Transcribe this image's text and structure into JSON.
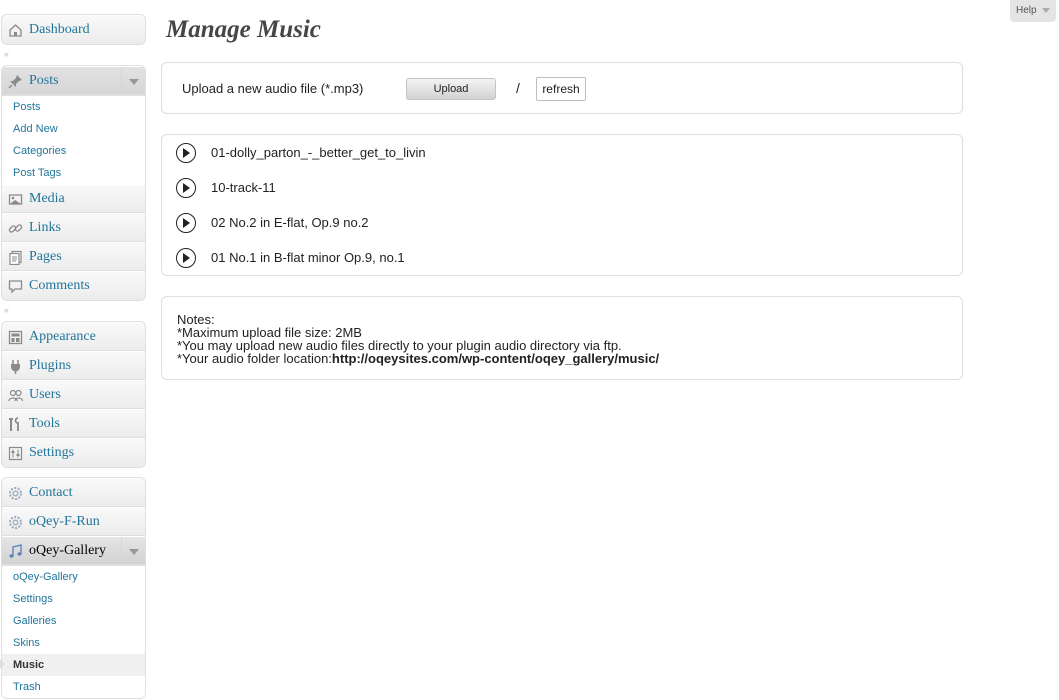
{
  "help": {
    "label": "Help"
  },
  "page": {
    "title": "Manage Music"
  },
  "upload": {
    "label": "Upload a new audio file (*.mp3)",
    "button_label": "Upload",
    "separator": "/",
    "refresh_label": "refresh"
  },
  "tracks": [
    {
      "title": "01-dolly_parton_-_better_get_to_livin"
    },
    {
      "title": "10-track-11"
    },
    {
      "title": "02 No.2 in E-flat, Op.9 no.2"
    },
    {
      "title": "01 No.1 in B-flat minor Op.9, no.1"
    }
  ],
  "notes": {
    "heading": "Notes:",
    "line1": "*Maximum upload file size: 2MB",
    "line2": "*You may upload new audio files directly to your plugin audio directory via ftp.",
    "line3_prefix": "*Your audio folder location:",
    "line3_path": "http://oqeysites.com/wp-content/oqey_gallery/music/"
  },
  "sidebar": {
    "dashboard": "Dashboard",
    "posts": {
      "label": "Posts",
      "items": [
        "Posts",
        "Add New",
        "Categories",
        "Post Tags"
      ]
    },
    "media": "Media",
    "links": "Links",
    "pages": "Pages",
    "comments": "Comments",
    "appearance": "Appearance",
    "plugins": "Plugins",
    "users": "Users",
    "tools": "Tools",
    "settings": "Settings",
    "contact": "Contact",
    "oqey_f_run": "oQey-F-Run",
    "oqey_gallery": {
      "label": "oQey-Gallery",
      "items": [
        "oQey-Gallery",
        "Settings",
        "Galleries",
        "Skins",
        "Music",
        "Trash"
      ]
    }
  },
  "colors": {
    "link": "#21759b",
    "title": "#464646",
    "border": "#dfdfdf"
  }
}
